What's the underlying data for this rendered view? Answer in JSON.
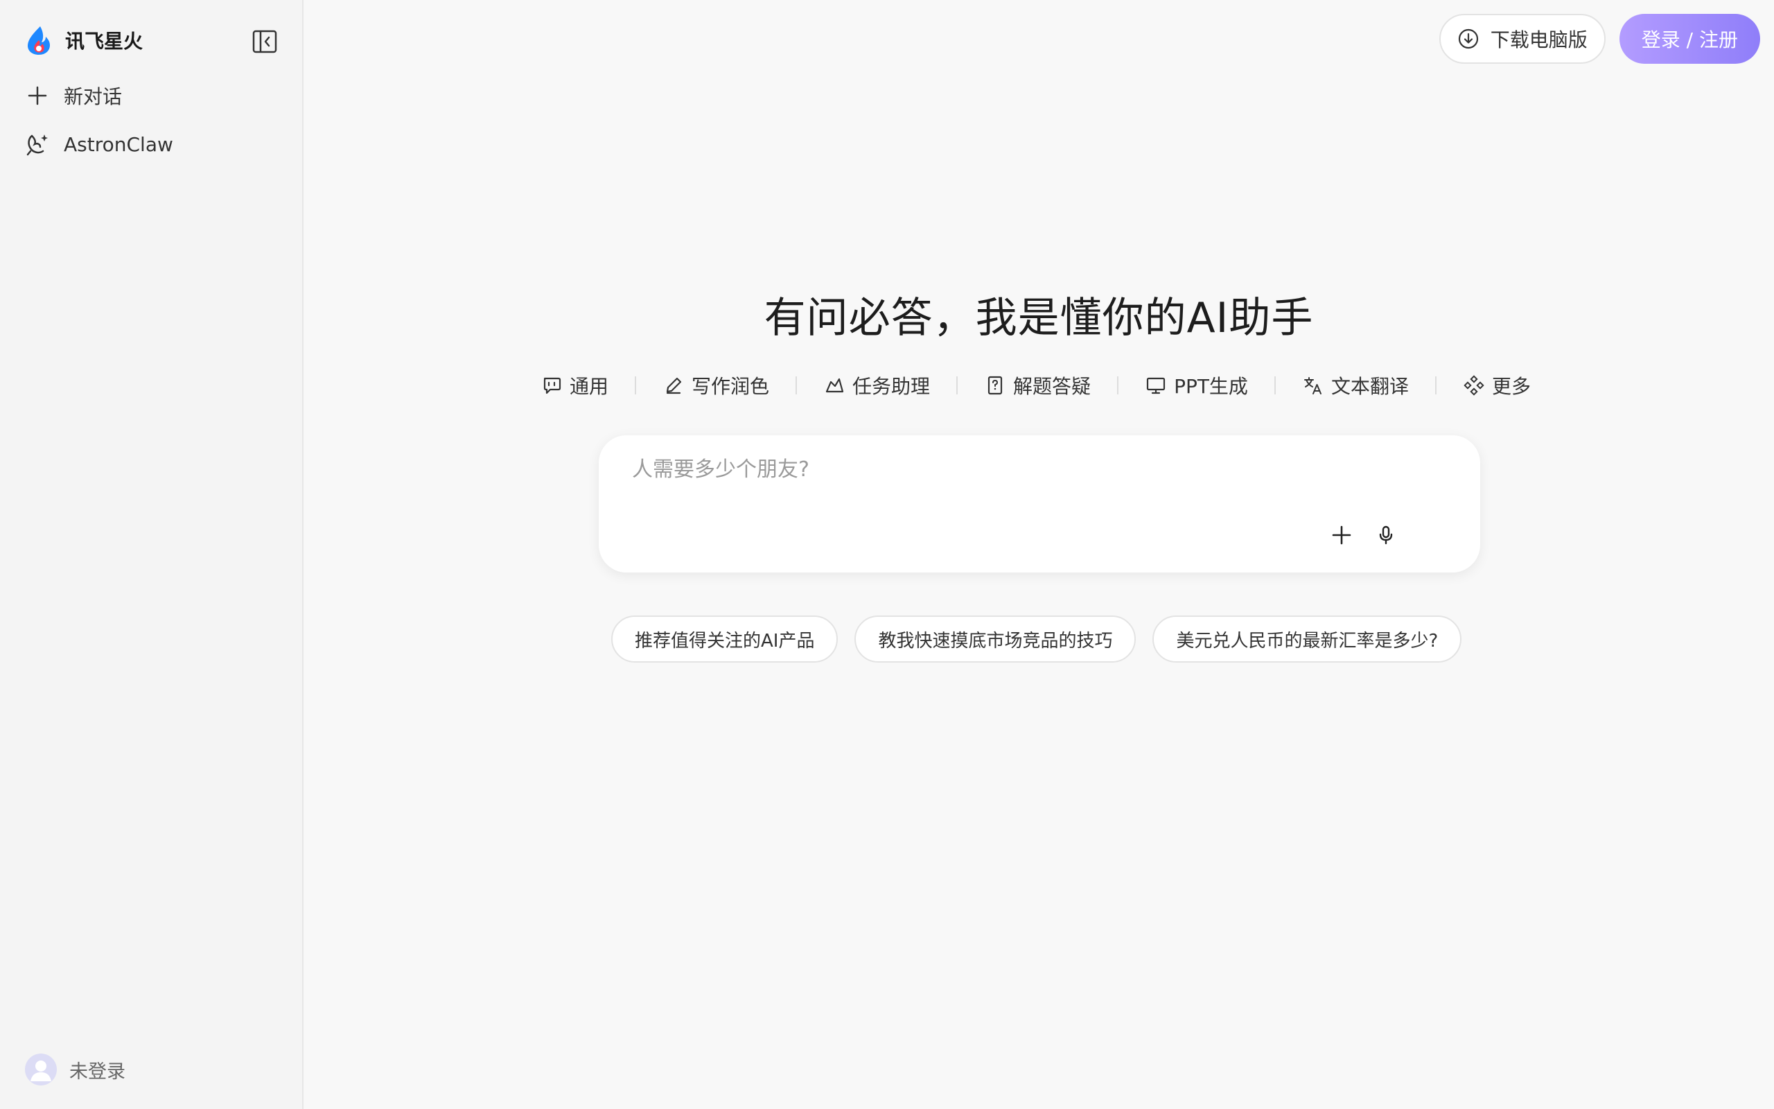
{
  "sidebar": {
    "brand_name": "讯飞星火",
    "items": [
      {
        "label": "新对话",
        "icon": "plus-icon"
      },
      {
        "label": "AstronClaw",
        "icon": "claw-icon"
      }
    ],
    "user_label": "未登录"
  },
  "header": {
    "download_label": "下载电脑版",
    "login_label": "登录 / 注册"
  },
  "main": {
    "title": "有问必答，我是懂你的AI助手",
    "modes": [
      {
        "label": "通用",
        "icon": "chat-bubble-icon"
      },
      {
        "label": "写作润色",
        "icon": "pen-icon"
      },
      {
        "label": "任务助理",
        "icon": "task-icon"
      },
      {
        "label": "解题答疑",
        "icon": "question-doc-icon"
      },
      {
        "label": "PPT生成",
        "icon": "presentation-icon"
      },
      {
        "label": "文本翻译",
        "icon": "translate-icon"
      },
      {
        "label": "更多",
        "icon": "more-grid-icon"
      }
    ],
    "input_placeholder": "人需要多少个朋友?",
    "suggestions": [
      "推荐值得关注的AI产品",
      "教我快速摸底市场竞品的技巧",
      "美元兑人民币的最新汇率是多少?"
    ]
  },
  "colors": {
    "accent_start": "#b39cff",
    "accent_end": "#8f7ef9",
    "sidebar_bg": "#f4f4f4",
    "page_bg": "#f8f8f8"
  }
}
